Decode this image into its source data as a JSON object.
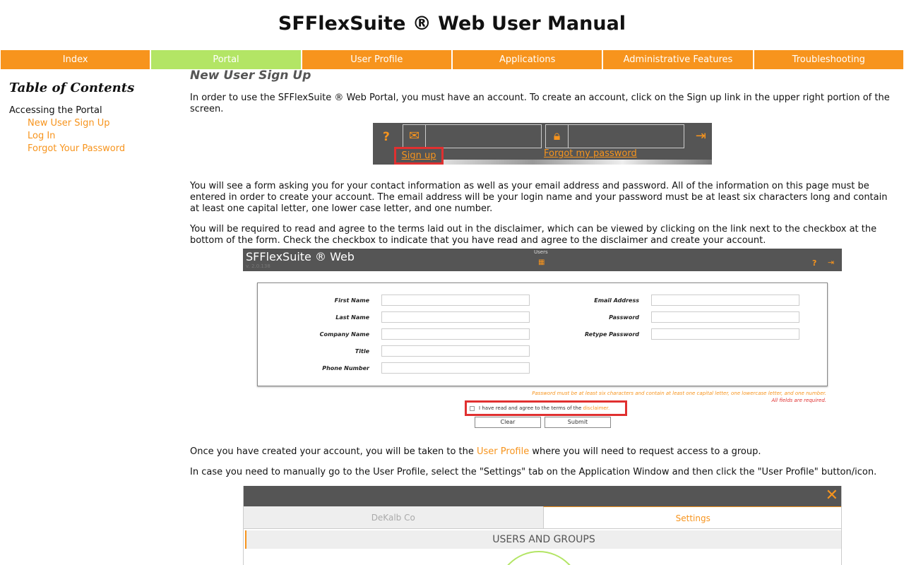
{
  "site": {
    "title": "SFFlexSuite ® Web User Manual"
  },
  "nav": {
    "items": [
      {
        "label": "Index"
      },
      {
        "label": "Portal"
      },
      {
        "label": "User Profile"
      },
      {
        "label": "Applications"
      },
      {
        "label": "Administrative Features"
      },
      {
        "label": "Troubleshooting"
      }
    ]
  },
  "toc": {
    "title": "Table of Contents",
    "section": "Accessing the Portal",
    "links": [
      {
        "label": "New User Sign Up"
      },
      {
        "label": "Log In"
      },
      {
        "label": "Forgot Your Password"
      }
    ]
  },
  "content": {
    "heading": "New User Sign Up",
    "p1": "In order to use the SFFlexSuite ® Web Portal, you must have an account. To create an account, click on the Sign up link in the upper right portion of the screen.",
    "p2": "You will see a form asking you for your contact information as well as your email address and password. All of the information on this page must be entered in order to create your account. The email address will be your login name and your password must be at least six characters long and contain at least one capital letter, one lower case letter, and one number.",
    "p3": "You will be required to read and agree to the terms laid out in the disclaimer, which can be viewed by clicking on the link next to the checkbox at the bottom of the form. Check the checkbox to indicate that you have read and agree to the disclaimer and create your account.",
    "p4_before": "Once you have created your account, you will be taken to the ",
    "p4_link": "User Profile",
    "p4_after": " where you will need to request access to a group.",
    "p5": "In case you need to manually go to the User Profile, select the \"Settings\" tab on the Application Window and then click the \"User Profile\" button/icon."
  },
  "login_shot": {
    "help": "?",
    "signup": "Sign up",
    "forgot": "Forgot my password"
  },
  "form_shot": {
    "app_title": "SFFlexSuite ® Web",
    "version": "v. 2.0.138",
    "users_label": "Users",
    "help": "?",
    "left_fields": [
      "First Name",
      "Last Name",
      "Company Name",
      "Title",
      "Phone Number"
    ],
    "right_fields": [
      "Email Address",
      "Password",
      "Retype Password"
    ],
    "note_password": "Password must be at least six characters and contain at least one capital letter, one lowercase letter, and one number.",
    "note_required": "All fields are required.",
    "disclaimer_text": "I have read and agree to the terms of the ",
    "disclaimer_link": "disclaimer.",
    "clear": "Clear",
    "submit": "Submit"
  },
  "settings_shot": {
    "tab_left": "DeKalb Co",
    "tab_right": "Settings",
    "section": "USERS AND GROUPS"
  },
  "colors": {
    "accent": "#f7941d",
    "active_nav": "#b3e565",
    "highlight": "#e03030"
  }
}
